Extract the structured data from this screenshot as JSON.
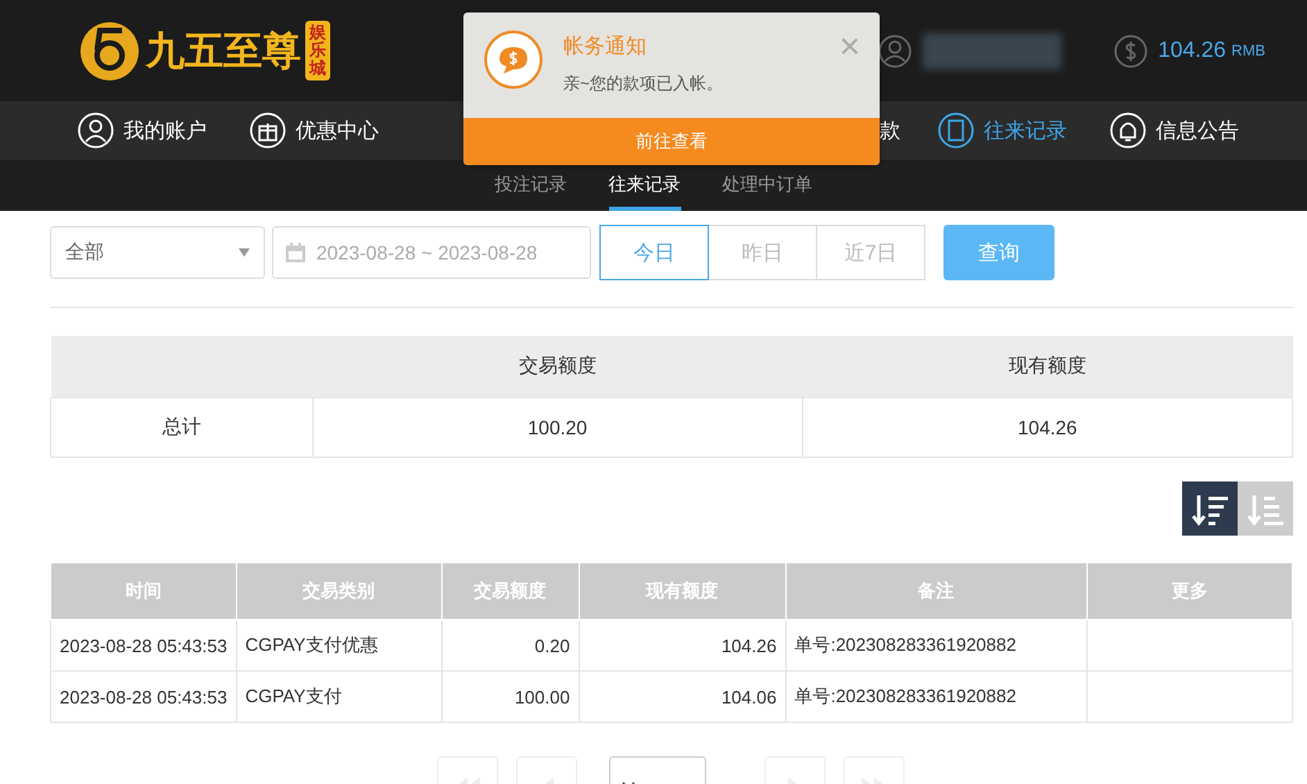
{
  "header": {
    "logo_text": "九五至尊",
    "logo_badge": "娱乐城",
    "balance": "104.26",
    "currency": "RMB"
  },
  "nav": [
    {
      "label": "我的账户",
      "selected": false
    },
    {
      "label": "优惠中心",
      "selected": false
    },
    {
      "label": "款",
      "selected": false
    },
    {
      "label": "往来记录",
      "selected": true
    },
    {
      "label": "信息公告",
      "selected": false
    }
  ],
  "subnav": [
    {
      "label": "投注记录",
      "selected": false
    },
    {
      "label": "往来记录",
      "selected": true
    },
    {
      "label": "处理中订单",
      "selected": false
    }
  ],
  "notification": {
    "title": "帐务通知",
    "message": "亲~您的款项已入帐。",
    "close": "×",
    "action": "前往查看"
  },
  "filters": {
    "type": "全部",
    "date_range": "2023-08-28 ~ 2023-08-28",
    "quick": [
      {
        "label": "今日",
        "selected": true
      },
      {
        "label": "昨日",
        "selected": false
      },
      {
        "label": "近7日",
        "selected": false
      }
    ],
    "query": "查询"
  },
  "summary": {
    "columns": [
      "交易额度",
      "现有额度"
    ],
    "label": "总计",
    "values": [
      "100.20",
      "104.26"
    ]
  },
  "sort": [
    {
      "selected": true
    },
    {
      "selected": false
    }
  ],
  "table": {
    "columns": [
      "时间",
      "交易类别",
      "交易额度",
      "现有额度",
      "备注",
      "更多"
    ],
    "rows": [
      [
        "2023-08-28 05:43:53",
        "CGPAY支付优惠",
        "0.20",
        "104.26",
        "单号:202308283361920882",
        ""
      ],
      [
        "2023-08-28 05:43:53",
        "CGPAY支付",
        "100.00",
        "104.06",
        "单号:202308283361920882",
        ""
      ]
    ]
  }
}
